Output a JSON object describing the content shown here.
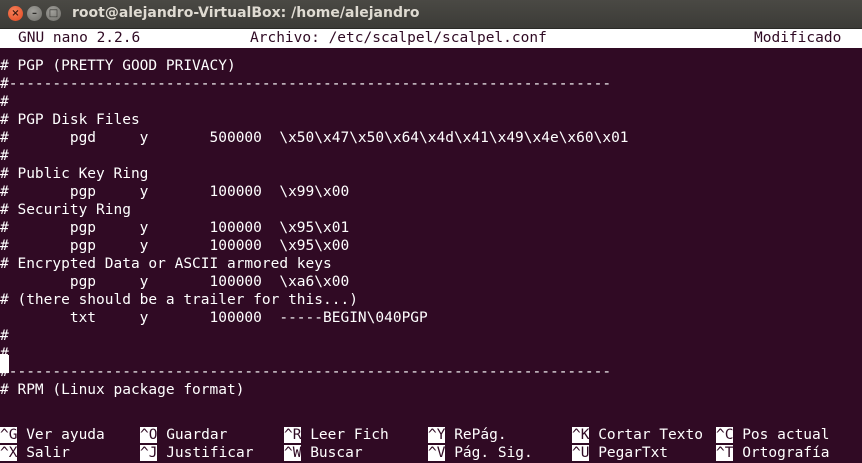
{
  "window": {
    "title": "root@alejandro-VirtualBox: /home/alejandro",
    "close_glyph": "×",
    "min_glyph": "–",
    "max_glyph": "□"
  },
  "nano": {
    "version": "GNU nano 2.2.6",
    "file": "Archivo: /etc/scalpel/scalpel.conf",
    "status": "Modificado"
  },
  "editor_lines": [
    "",
    "# PGP (PRETTY GOOD PRIVACY)",
    "#---------------------------------------------------------------------",
    "#",
    "# PGP Disk Files",
    "#       pgd     y       500000  \\x50\\x47\\x50\\x64\\x4d\\x41\\x49\\x4e\\x60\\x01",
    "#",
    "# Public Key Ring",
    "#       pgp     y       100000  \\x99\\x00",
    "# Security Ring",
    "#       pgp     y       100000  \\x95\\x01",
    "#       pgp     y       100000  \\x95\\x00",
    "# Encrypted Data or ASCII armored keys",
    "        pgp     y       100000  \\xa6\\x00",
    "# (there should be a trailer for this...)",
    "        txt     y       100000  -----BEGIN\\040PGP",
    "#",
    "#",
    "#---------------------------------------------------------------------",
    "# RPM (Linux package format)"
  ],
  "shortcuts_row1": [
    {
      "key": "^G",
      "label": " Ver ayuda"
    },
    {
      "key": "^O",
      "label": " Guardar"
    },
    {
      "key": "^R",
      "label": " Leer Fich"
    },
    {
      "key": "^Y",
      "label": " RePág."
    },
    {
      "key": "^K",
      "label": " Cortar Texto"
    },
    {
      "key": "^C",
      "label": " Pos actual"
    }
  ],
  "shortcuts_row2": [
    {
      "key": "^X",
      "label": " Salir"
    },
    {
      "key": "^J",
      "label": " Justificar"
    },
    {
      "key": "^W",
      "label": " Buscar"
    },
    {
      "key": "^V",
      "label": " Pág. Sig."
    },
    {
      "key": "^U",
      "label": " PegarTxt"
    },
    {
      "key": "^T",
      "label": " Ortografía"
    }
  ],
  "colors": {
    "terminal_bg": "#300a24",
    "terminal_fg": "#ffffff",
    "titlebar_bg": "#3c3b37",
    "close_button": "#e0461f"
  }
}
